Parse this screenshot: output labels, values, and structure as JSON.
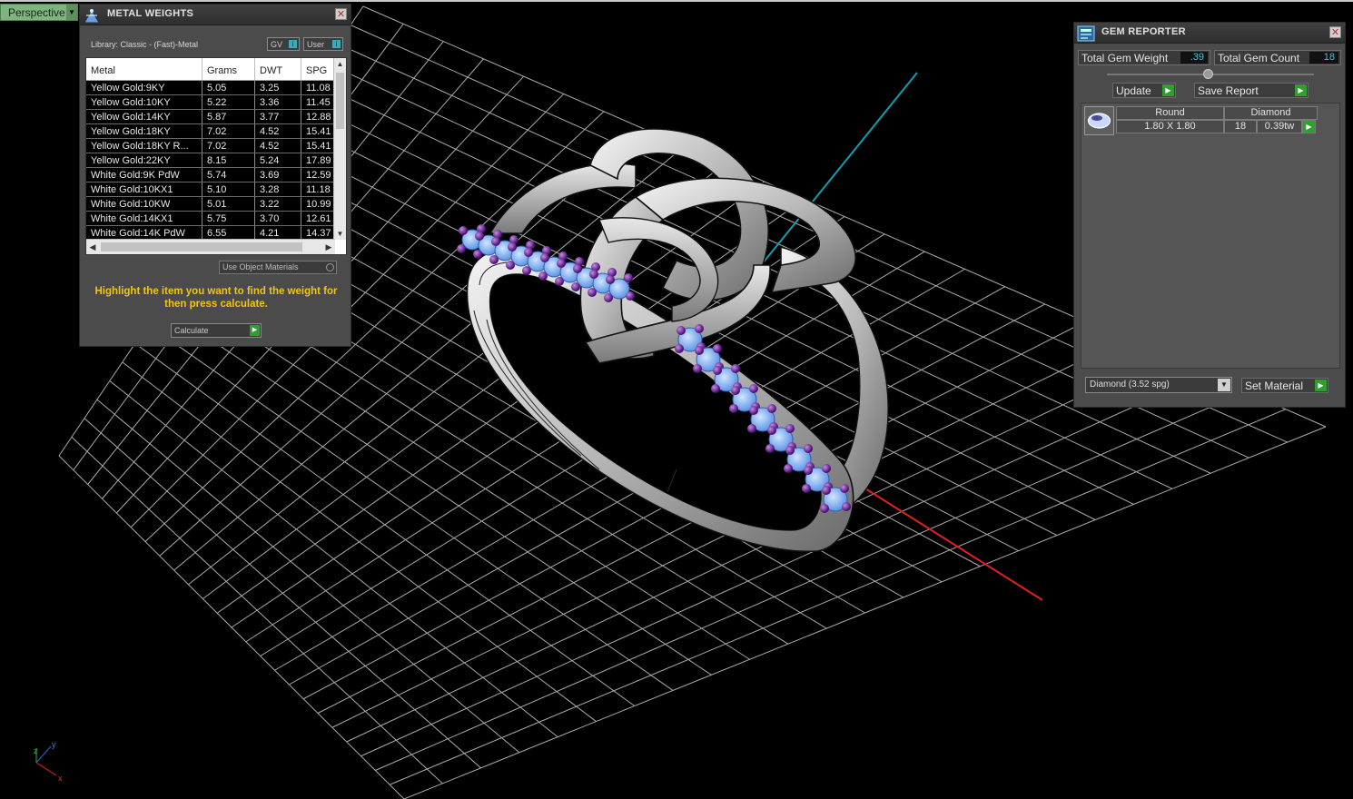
{
  "viewport": {
    "mode": "Perspective"
  },
  "metal_weights": {
    "title": "METAL WEIGHTS",
    "library": "Library: Classic - (Fast)-Metal",
    "toggles": [
      "GV",
      "User"
    ],
    "columns": [
      "Metal",
      "Grams",
      "DWT",
      "SPG"
    ],
    "rows": [
      [
        "Yellow Gold:9KY",
        "5.05",
        "3.25",
        "11.08"
      ],
      [
        "Yellow Gold:10KY",
        "5.22",
        "3.36",
        "11.45"
      ],
      [
        "Yellow Gold:14KY",
        "5.87",
        "3.77",
        "12.88"
      ],
      [
        "Yellow Gold:18KY",
        "7.02",
        "4.52",
        "15.41"
      ],
      [
        "Yellow Gold:18KY R...",
        "7.02",
        "4.52",
        "15.41"
      ],
      [
        "Yellow Gold:22KY",
        "8.15",
        "5.24",
        "17.89"
      ],
      [
        "White Gold:9K PdW",
        "5.74",
        "3.69",
        "12.59"
      ],
      [
        "White Gold:10KX1",
        "5.10",
        "3.28",
        "11.18"
      ],
      [
        "White Gold:10KW",
        "5.01",
        "3.22",
        "10.99"
      ],
      [
        "White Gold:14KX1",
        "5.75",
        "3.70",
        "12.61"
      ],
      [
        "White Gold:14K PdW",
        "6.55",
        "4.21",
        "14.37"
      ]
    ],
    "use_object_materials": "Use Object Materials",
    "hint": "Highlight the item you want to find the weight for then press calculate.",
    "calculate": "Calculate"
  },
  "gem_reporter": {
    "title": "GEM REPORTER",
    "total_weight_label": "Total Gem Weight",
    "total_weight_value": ".39",
    "total_count_label": "Total Gem Count",
    "total_count_value": "18",
    "update": "Update",
    "save_report": "Save Report",
    "gem": {
      "shape": "Round",
      "material": "Diamond",
      "size": "1.80 X 1.80",
      "count": "18",
      "weight": "0.39tw"
    },
    "material_select": "Diamond    (3.52 spg)",
    "set_material": "Set Material"
  },
  "axis_labels": {
    "x": "x",
    "y": "y",
    "z": "z"
  },
  "colors": {
    "x_axis": "#e02020",
    "y_axis": "#10a0b0",
    "grid": "#c8c8c8",
    "accent_green": "#2fa02f"
  }
}
